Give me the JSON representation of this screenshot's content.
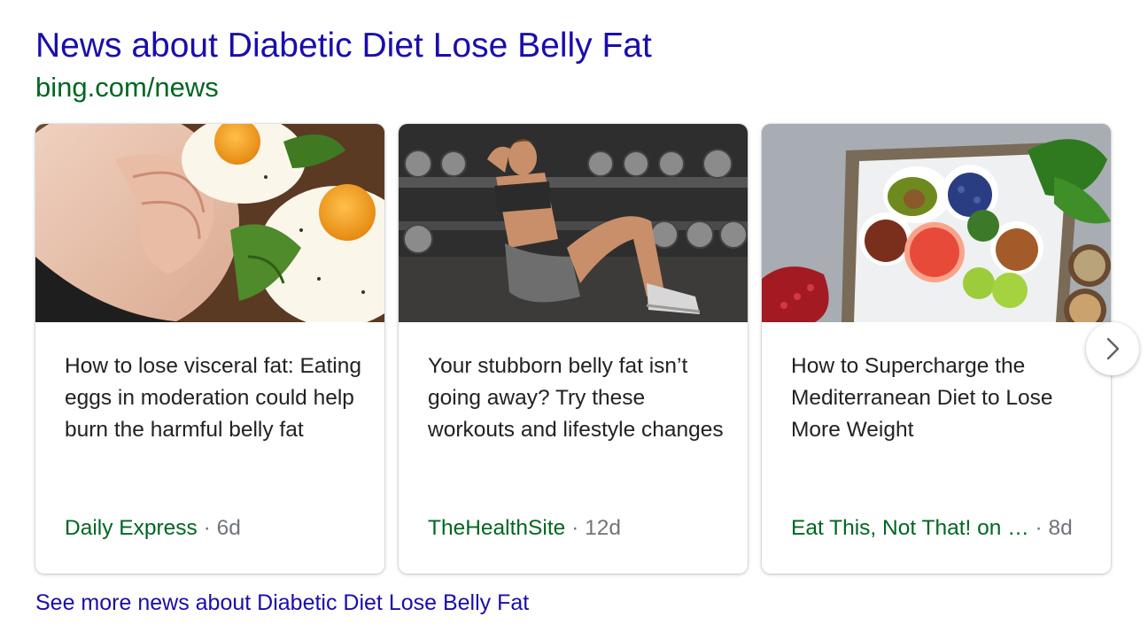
{
  "result": {
    "title": "News about Diabetic Diet Lose Belly Fat",
    "url": "bing.com/news"
  },
  "cards": [
    {
      "headline": "How to lose visceral fat: Eating eggs in moderation could help burn the harmful belly fat",
      "source": "Daily Express",
      "separator": "·",
      "age": "6d"
    },
    {
      "headline": "Your stubborn belly fat isn’t going away? Try these workouts and lifestyle changes",
      "source": "TheHealthSite",
      "separator": "·",
      "age": "12d"
    },
    {
      "headline": "How to Supercharge the Mediterranean Diet to Lose More Weight",
      "source": "Eat This, Not That! on …",
      "separator": "·",
      "age": "8d"
    }
  ],
  "carousel": {
    "next_icon": "chevron-right-icon"
  },
  "footer": {
    "see_more": "See more news about Diabetic Diet Lose Belly Fat"
  },
  "colors": {
    "link": "#1a0dab",
    "url_green": "#006621",
    "text": "#222222",
    "muted": "#70757a"
  }
}
